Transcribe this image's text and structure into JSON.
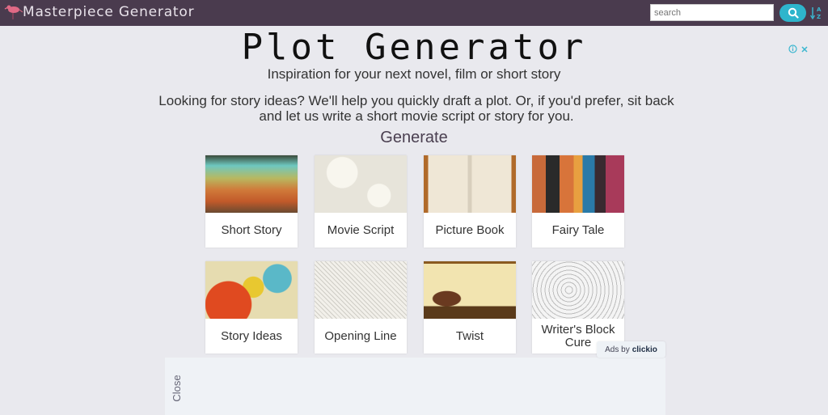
{
  "header": {
    "brand": "Masterpiece Generator",
    "search_placeholder": "search",
    "search_value": "",
    "colors": {
      "bar": "#4a3b4e",
      "accent": "#2eb5cc"
    }
  },
  "main": {
    "title": "Plot Generator",
    "subtitle": "Inspiration for your next novel, film or short story",
    "intro": "Looking for story ideas? We'll help you quickly draft a plot. Or, if you'd prefer, sit back and let us write a short movie script or story for you.",
    "generate_heading": "Generate",
    "cards": [
      {
        "label": "Short Story",
        "image": "colorful-brick-wall"
      },
      {
        "label": "Movie Script",
        "image": "sketch-speech-bubbles"
      },
      {
        "label": "Picture Book",
        "image": "open-book-drawings"
      },
      {
        "label": "Fairy Tale",
        "image": "witches-figures"
      },
      {
        "label": "Story Ideas",
        "image": "colorful-clouds"
      },
      {
        "label": "Opening Line",
        "image": "doodle-crowd"
      },
      {
        "label": "Twist",
        "image": "figure-at-desk"
      },
      {
        "label": "Writer's Block Cure",
        "image": "doodle-pattern"
      }
    ]
  },
  "ads": {
    "ads_by": "Ads by",
    "provider": "clickio",
    "close_label": "Close",
    "info_icon": "info-icon",
    "close_icon": "close-icon"
  }
}
